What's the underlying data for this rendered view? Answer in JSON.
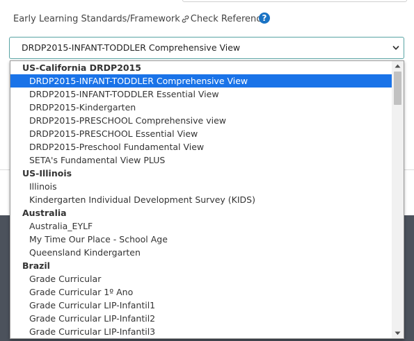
{
  "field": {
    "label": "Early Learning Standards/Framework",
    "reference_link": "Check Reference",
    "help_glyph": "?"
  },
  "select": {
    "value": "DRDP2015-INFANT-TODDLER Comprehensive View"
  },
  "dropdown": {
    "options": [
      {
        "label": "US-California DRDP2015",
        "group": true
      },
      {
        "label": "DRDP2015-INFANT-TODDLER Comprehensive View",
        "selected": true
      },
      {
        "label": "DRDP2015-INFANT-TODDLER Essential View"
      },
      {
        "label": "DRDP2015-Kindergarten"
      },
      {
        "label": "DRDP2015-PRESCHOOL Comprehensive view"
      },
      {
        "label": "DRDP2015-PRESCHOOL Essential View"
      },
      {
        "label": "DRDP2015-Preschool Fundamental View"
      },
      {
        "label": "SETA's Fundamental View PLUS"
      },
      {
        "label": "US-Illinois",
        "group": true
      },
      {
        "label": "Illinois"
      },
      {
        "label": "Kindergarten Individual Development Survey (KIDS)"
      },
      {
        "label": "Australia",
        "group": true
      },
      {
        "label": "Australia_EYLF"
      },
      {
        "label": "My Time Our Place - School Age"
      },
      {
        "label": "Queensland Kindergarten"
      },
      {
        "label": "Brazil",
        "group": true
      },
      {
        "label": "Grade Curricular"
      },
      {
        "label": "Grade Curricular 1º Ano"
      },
      {
        "label": "Grade Curricular LIP-Infantil1"
      },
      {
        "label": "Grade Curricular LIP-Infantil2"
      },
      {
        "label": "Grade Curricular LIP-Infantil3"
      }
    ]
  },
  "icons": {
    "link": "link-icon",
    "help": "help-icon",
    "chevron": "chevron-down-icon"
  },
  "colors": {
    "selected_bg": "#1a73e8",
    "help_icon": "#1a73c4",
    "select_border": "#57a3a3"
  }
}
